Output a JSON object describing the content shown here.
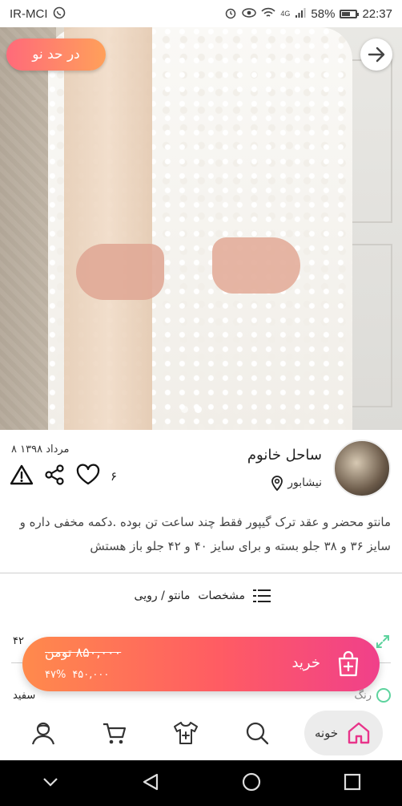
{
  "status_bar": {
    "carrier": "IR-MCI",
    "network_type": "4G",
    "battery_percent": "58%",
    "battery_level": 0.58,
    "time": "22:37"
  },
  "listing": {
    "condition_badge": "در حد نو",
    "image_count": 2,
    "active_image": 2,
    "post_date": "۸ مرداد ۱۳۹۸",
    "like_count": "۶",
    "seller": {
      "name": "ساحل خانوم",
      "location": "نیشابور"
    },
    "description": "مانتو محضر و عقد ترک گیپور فقط چند ساعت تن بوده .دکمه مخفی داره و سایز ۳۶ و ۳۸ جلو بسته و برای سایز ۴۰ و ۴۲ جلو باز هستش",
    "specs_label": "مشخصات",
    "category": "مانتو / رویی",
    "partial_size_text": "۴۲",
    "color_label": "رنگ",
    "color_value": "سفید"
  },
  "buy_bar": {
    "old_price": "۸۵۰,۰۰۰ تومن",
    "discount": "۴۷%",
    "new_price": "۴۵۰,۰۰۰",
    "buy_label": "خرید"
  },
  "bottom_nav": {
    "home_label": "خونه",
    "accent": "#e8348a"
  },
  "colors": {
    "gradient_start": "#ff8a4c",
    "gradient_end": "#f0408a",
    "accent_green": "#5dd39e"
  }
}
